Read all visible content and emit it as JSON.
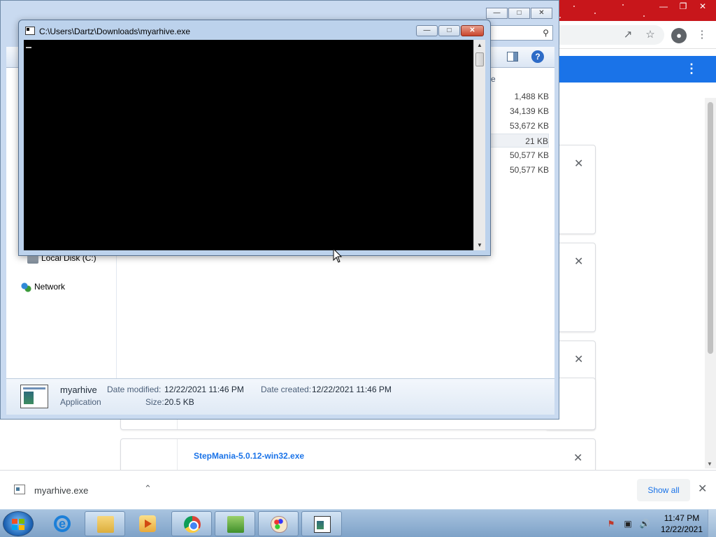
{
  "console": {
    "title": "C:\\Users\\Dartz\\Downloads\\myarhive.exe"
  },
  "explorer": {
    "nav": {
      "local_disk": "Local Disk (C:)",
      "network": "Network"
    },
    "column_header_fragment": "e",
    "sizes": [
      "1,488 KB",
      "34,139 KB",
      "53,672 KB",
      "21 KB",
      "50,577 KB",
      "50,577 KB"
    ],
    "details": {
      "name": "myarhive",
      "type": "Application",
      "date_modified_label": "Date modified:",
      "date_modified": "12/22/2021 11:46 PM",
      "date_created_label": "Date created:",
      "date_created": "12/22/2021 11:46 PM",
      "size_label": "Size:",
      "size": "20.5 KB"
    }
  },
  "chrome": {
    "download_item_name": "StepMania-5.0.12-win32.exe",
    "shelf": {
      "file_name": "myarhive.exe",
      "show_all": "Show all"
    }
  },
  "taskbar": {
    "clock_time": "11:47 PM",
    "clock_date": "12/22/2021",
    "apps": [
      "internet-explorer",
      "file-explorer",
      "media-player",
      "google-chrome",
      "notepad-plus-plus",
      "paint",
      "console"
    ]
  },
  "colors": {
    "chrome_accent": "#1a73e8",
    "chrome_theme_red": "#c8161b",
    "console_bg": "#000000"
  }
}
